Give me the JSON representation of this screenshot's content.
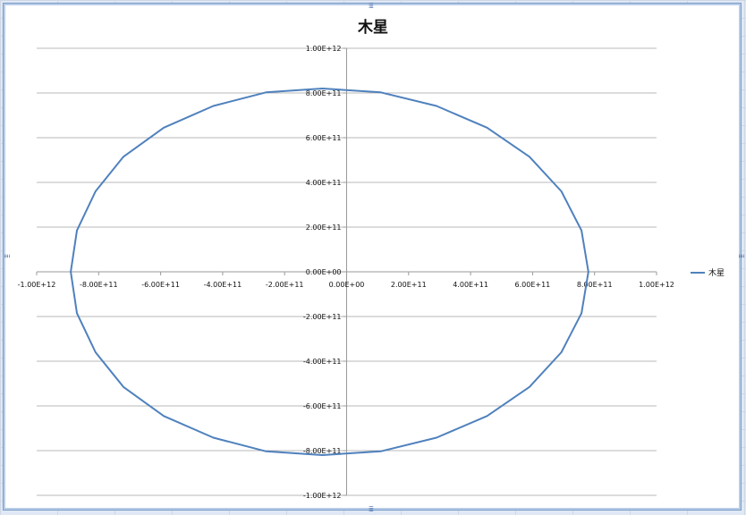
{
  "chart_data": {
    "type": "scatter",
    "title": "木星",
    "xlabel": "",
    "ylabel": "",
    "xlim": [
      -1000000000000,
      1000000000000
    ],
    "ylim": [
      -1000000000000,
      1000000000000
    ],
    "x_ticks": [
      "-1.00E+12",
      "-8.00E+11",
      "-6.00E+11",
      "-4.00E+11",
      "-2.00E+11",
      "0.00E+00",
      "2.00E+11",
      "4.00E+11",
      "6.00E+11",
      "8.00E+11",
      "1.00E+12"
    ],
    "y_ticks": [
      "1.00E+12",
      "8.00E+11",
      "6.00E+11",
      "4.00E+11",
      "2.00E+11",
      "0.00E+00",
      "-2.00E+11",
      "-4.00E+11",
      "-6.00E+11",
      "-8.00E+11",
      "-1.00E+12"
    ],
    "grid": "horizontal",
    "legend_position": "right",
    "series": [
      {
        "name": "木星",
        "color": "#4f81bd",
        "x": [
          780000000000.0,
          758000000000.0,
          693000000000.0,
          590000000000.0,
          453000000000.0,
          290000000000.0,
          110000000000.0,
          -78000000000.0,
          -260000000000.0,
          -430000000000.0,
          -590000000000.0,
          -720000000000.0,
          -810000000000.0,
          -870000000000.0,
          -890000000000.0,
          -870000000000.0,
          -810000000000.0,
          -720000000000.0,
          -590000000000.0,
          -430000000000.0,
          -260000000000.0,
          -78000000000.0,
          110000000000.0,
          290000000000.0,
          453000000000.0,
          590000000000.0,
          693000000000.0,
          758000000000.0,
          780000000000.0
        ],
        "y": [
          0,
          185000000000.0,
          360000000000.0,
          515000000000.0,
          645000000000.0,
          742000000000.0,
          803000000000.0,
          820000000000.0,
          803000000000.0,
          742000000000.0,
          645000000000.0,
          515000000000.0,
          360000000000.0,
          185000000000.0,
          0,
          -185000000000.0,
          -360000000000.0,
          -515000000000.0,
          -645000000000.0,
          -742000000000.0,
          -803000000000.0,
          -820000000000.0,
          -803000000000.0,
          -742000000000.0,
          -645000000000.0,
          -515000000000.0,
          -360000000000.0,
          -185000000000.0,
          0
        ]
      }
    ]
  }
}
